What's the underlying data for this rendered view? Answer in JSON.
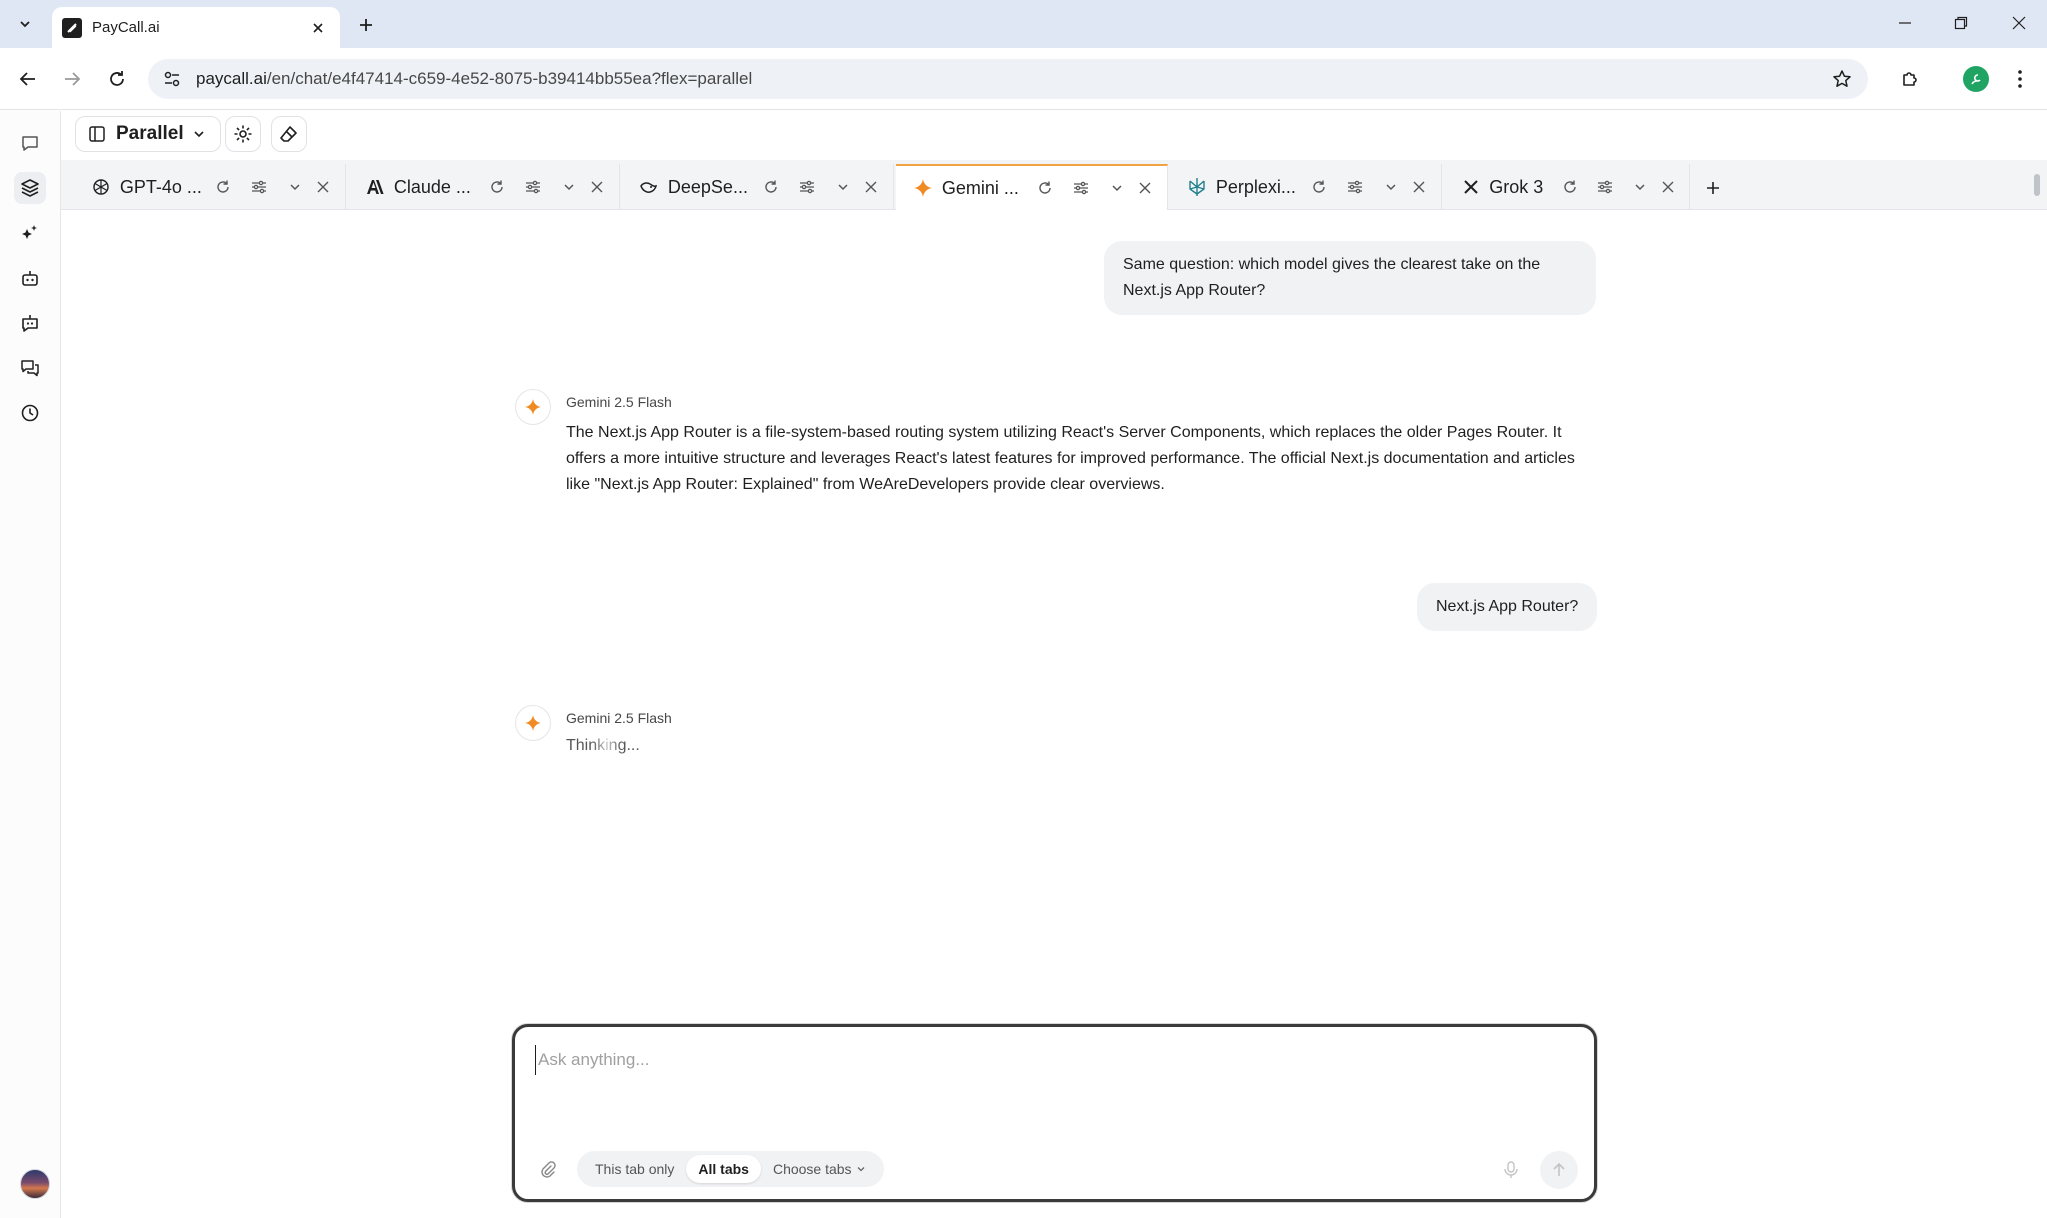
{
  "browser": {
    "tab_title": "PayCall.ai",
    "url_host": "paycall.ai",
    "url_path": "/en/chat/e4f47414-c659-4e52-8075-b39414bb55ea?flex=parallel"
  },
  "app": {
    "mode_label": "Parallel",
    "model_tabs": [
      {
        "name": "GPT-4o ...",
        "icon": "openai-icon"
      },
      {
        "name": "Claude ...",
        "icon": "anthropic-icon"
      },
      {
        "name": "DeepSe...",
        "icon": "deepseek-icon"
      },
      {
        "name": "Gemini ...",
        "icon": "gemini-icon",
        "active": true
      },
      {
        "name": "Perplexi...",
        "icon": "perplexity-icon"
      },
      {
        "name": "Grok 3",
        "icon": "grok-icon"
      }
    ]
  },
  "chat": {
    "messages": [
      {
        "role": "user",
        "text": "Same question: which model gives the clearest take on the Next.js App Router?"
      },
      {
        "role": "assistant",
        "model": "Gemini 2.5 Flash",
        "text": "The Next.js App Router is a file-system-based routing system utilizing React's Server Components, which replaces the older Pages Router. It offers a more intuitive structure and leverages React's latest features for improved performance. The official Next.js documentation and articles like \"Next.js App Router: Explained\" from WeAreDevelopers provide clear overviews."
      },
      {
        "role": "user",
        "text": "Next.js App Router?"
      },
      {
        "role": "assistant",
        "model": "Gemini 2.5 Flash",
        "status": "Thinking..."
      }
    ]
  },
  "composer": {
    "placeholder": "Ask anything...",
    "scope_options": [
      "This tab only",
      "All tabs",
      "Choose tabs"
    ],
    "selected_scope": "All tabs"
  },
  "colors": {
    "tabstrip_bg": "#dfe7f4",
    "active_tab_accent": "#f0a340",
    "gemini_orange": "#f08a24",
    "profile_green": "#1fa463"
  }
}
